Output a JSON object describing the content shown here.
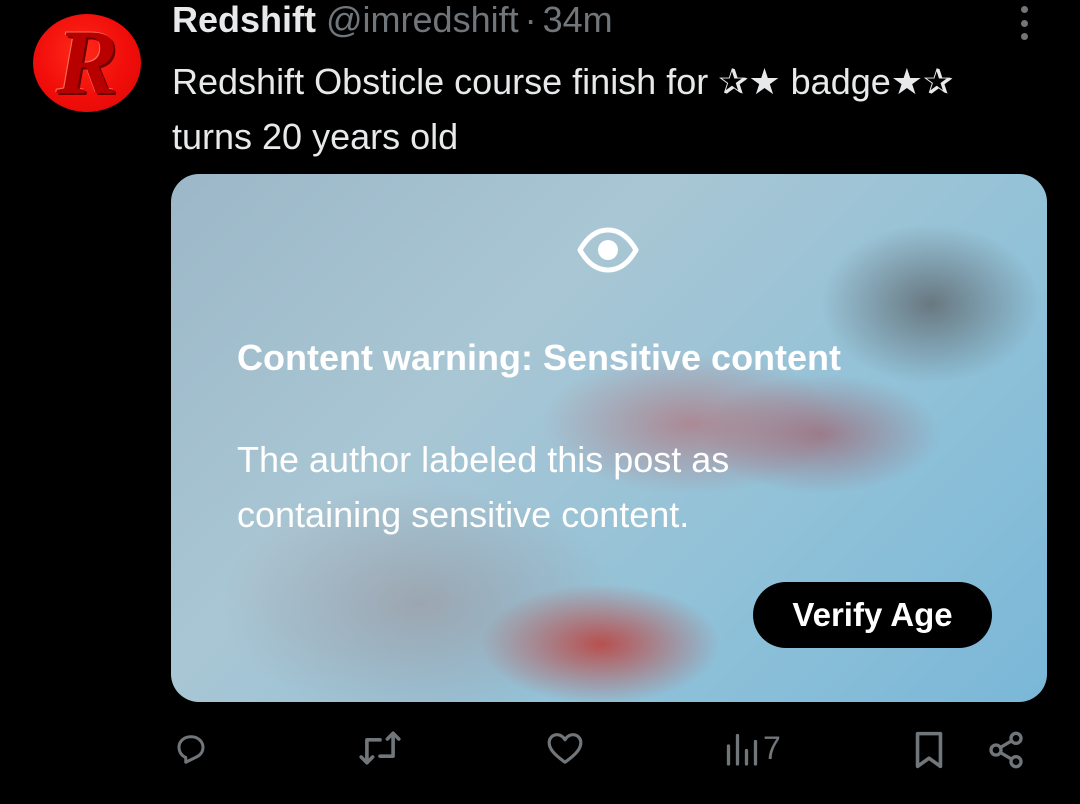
{
  "post": {
    "display_name": "Redshift",
    "handle": "@imredshift",
    "separator": "·",
    "time": "34m",
    "avatar_letter": "R",
    "text": "Redshift Obsticle course finish for ✰★ badge★✰ turns 20 years old"
  },
  "media": {
    "warning_title": "Content warning: Sensitive content",
    "warning_body": "The author labeled this post as containing sensitive content.",
    "verify_button": "Verify Age"
  },
  "actions": {
    "views_count": "7"
  },
  "icons": [
    "more-icon",
    "eye-icon",
    "reply-icon",
    "repost-icon",
    "like-icon",
    "views-icon",
    "bookmark-icon",
    "share-icon"
  ],
  "colors": {
    "background": "#000000",
    "text_primary": "#e7e9ea",
    "text_secondary": "#71767b",
    "avatar_red": "#f10d0a"
  }
}
